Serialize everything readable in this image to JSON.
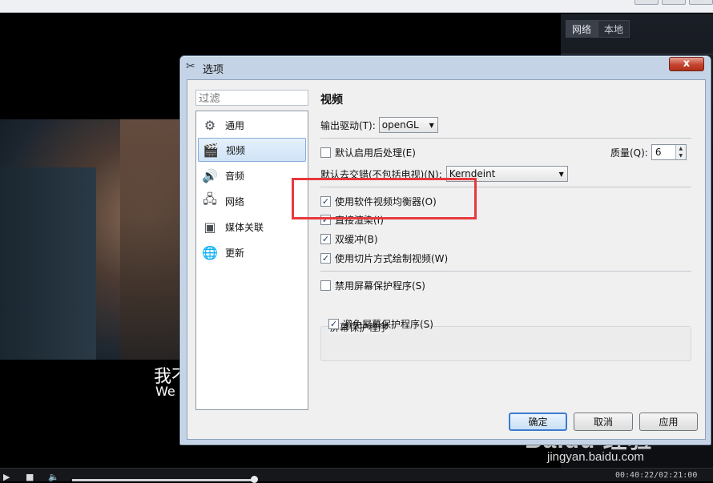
{
  "side_panel": {
    "tabs": [
      "网络",
      "本地"
    ]
  },
  "subtitle": {
    "cn": "我不",
    "en": "We"
  },
  "player": {
    "timecode": "00:40:22/02:21:00"
  },
  "watermark": {
    "logo": "Baidu 经验",
    "url": "jingyan.baidu.com"
  },
  "dialog": {
    "title": "选项",
    "close_label": "x",
    "filter_placeholder": "过滤",
    "nav": [
      {
        "label": "通用",
        "icon": "gear-icon"
      },
      {
        "label": "视频",
        "icon": "film-icon"
      },
      {
        "label": "音频",
        "icon": "speaker-icon"
      },
      {
        "label": "网络",
        "icon": "network-icon"
      },
      {
        "label": "媒体关联",
        "icon": "media-assoc-icon"
      },
      {
        "label": "更新",
        "icon": "update-globe-icon"
      }
    ],
    "page_title": "视频",
    "output_driver": {
      "label": "输出驱动(T):",
      "value": "openGL"
    },
    "postprocess": {
      "label": "默认启用后处理(E)",
      "checked": false
    },
    "quality": {
      "label": "质量(Q):",
      "value": "6"
    },
    "deinterlace": {
      "label": "默认去交错(不包括电视)(N):",
      "value": "Kerndeint"
    },
    "sw_eq": {
      "label": "使用软件视频均衡器(O)",
      "checked": true
    },
    "direct_render": {
      "label": "直接渲染(I)",
      "checked": true
    },
    "double_buffer": {
      "label": "双缓冲(B)",
      "checked": true
    },
    "slice_draw": {
      "label": "使用切片方式绘制视频(W)",
      "checked": true
    },
    "disable_screensaver": {
      "label": "禁用屏幕保护程序(S)",
      "checked": false
    },
    "screensaver_group": {
      "title": "屏幕保护程序",
      "avoid": {
        "label": "避免屏幕保护程序(S)",
        "checked": true
      }
    },
    "buttons": {
      "ok": "确定",
      "cancel": "取消",
      "apply": "应用"
    }
  }
}
